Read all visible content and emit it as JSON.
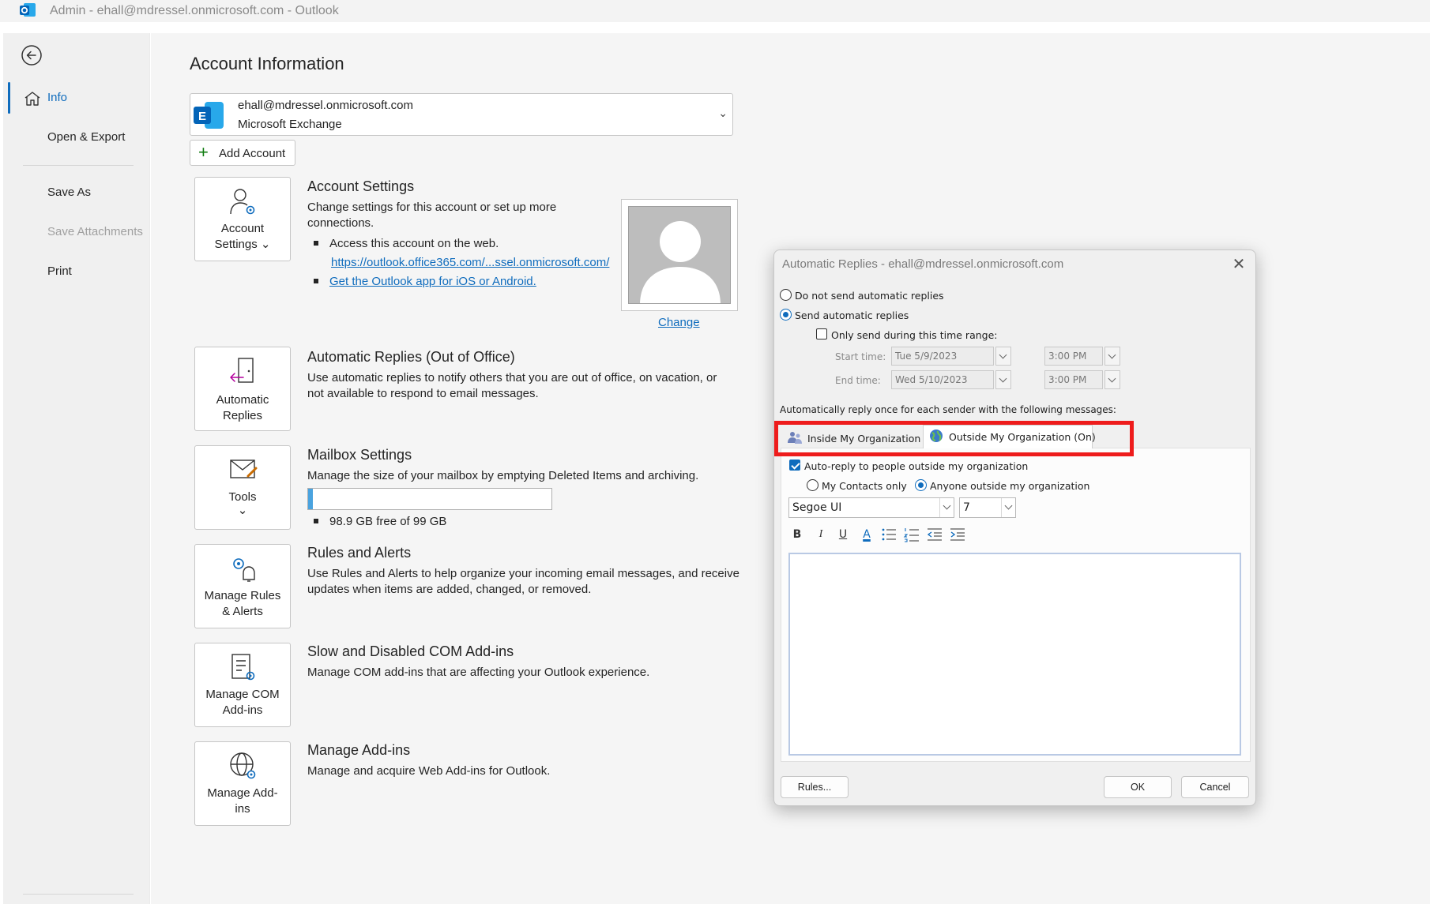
{
  "window": {
    "title": "Admin - ehall@mdressel.onmicrosoft.com  -  Outlook",
    "app_icon": "outlook-icon"
  },
  "nav": {
    "items": [
      {
        "label": "Info",
        "state": "active"
      },
      {
        "label": "Open & Export",
        "state": "normal"
      },
      {
        "label": "Save As",
        "state": "normal"
      },
      {
        "label": "Save Attachments",
        "state": "disabled"
      },
      {
        "label": "Print",
        "state": "normal"
      }
    ]
  },
  "page": {
    "title": "Account Information",
    "account": {
      "email": "ehall@mdressel.onmicrosoft.com",
      "type": "Microsoft Exchange",
      "chevron": "⌄"
    },
    "add_account_label": "Add Account",
    "change_link": "Change"
  },
  "tiles": {
    "account_settings": {
      "line1": "Account",
      "line2": "Settings ⌄"
    },
    "automatic_replies": {
      "line1": "Automatic",
      "line2": "Replies"
    },
    "tools": {
      "line1": "Tools",
      "line2": "⌄"
    },
    "rules": {
      "line1": "Manage Rules",
      "line2": "& Alerts"
    },
    "com": {
      "line1": "Manage COM",
      "line2": "Add-ins"
    },
    "addins": {
      "line1": "Manage Add-",
      "line2": "ins"
    }
  },
  "sections": {
    "account_settings": {
      "title": "Account Settings",
      "desc_line1": "Change settings for this account or set up more",
      "desc_line2": "connections.",
      "bullet1": "Access this account on the web.",
      "web_link": "https://outlook.office365.com/...ssel.onmicrosoft.com/",
      "app_link": "Get the Outlook app for iOS or Android."
    },
    "automatic_replies": {
      "title": "Automatic Replies (Out of Office)",
      "desc_line1": "Use automatic replies to notify others that you are out of office, on vacation, or",
      "desc_line2": "not available to respond to email messages."
    },
    "mailbox": {
      "title": "Mailbox Settings",
      "desc": "Manage the size of your mailbox by emptying Deleted Items and archiving.",
      "free": "98.9 GB free of 99 GB",
      "used_fraction": 0.011
    },
    "rules": {
      "title": "Rules and Alerts",
      "desc_line1": "Use Rules and Alerts to help organize your incoming email messages, and receive",
      "desc_line2": "updates when items are added, changed, or removed."
    },
    "com": {
      "title": "Slow and Disabled COM Add-ins",
      "desc": "Manage COM add-ins that are affecting your Outlook experience."
    },
    "addins": {
      "title": "Manage Add-ins",
      "desc": "Manage and acquire Web Add-ins for Outlook."
    }
  },
  "dialog": {
    "title": "Automatic Replies - ehall@mdressel.onmicrosoft.com",
    "opt_no": "Do not send automatic replies",
    "opt_yes": "Send automatic replies",
    "time_range": "Only send during this time range:",
    "start_label": "Start time:",
    "start_date": "Tue 5/9/2023",
    "start_time": "3:00 PM",
    "end_label": "End time:",
    "end_date": "Wed 5/10/2023",
    "end_time": "3:00 PM",
    "reply_once": "Automatically reply once for each sender with the following messages:",
    "tab_inside": "Inside My Organization",
    "tab_outside": "Outside My Organization (On)",
    "auto_reply_outside": "Auto-reply to people outside my organization",
    "my_contacts": "My Contacts only",
    "anyone_outside": "Anyone outside my organization",
    "font_name": "Segoe UI",
    "font_size": "7",
    "fmt_bold": "B",
    "fmt_italic": "I",
    "fmt_underline": "U",
    "fmt_color": "A",
    "rules_btn": "Rules...",
    "ok_btn": "OK",
    "cancel_btn": "Cancel",
    "highlight_color": "#ee1c1c",
    "accent": "#0f6cbd"
  }
}
